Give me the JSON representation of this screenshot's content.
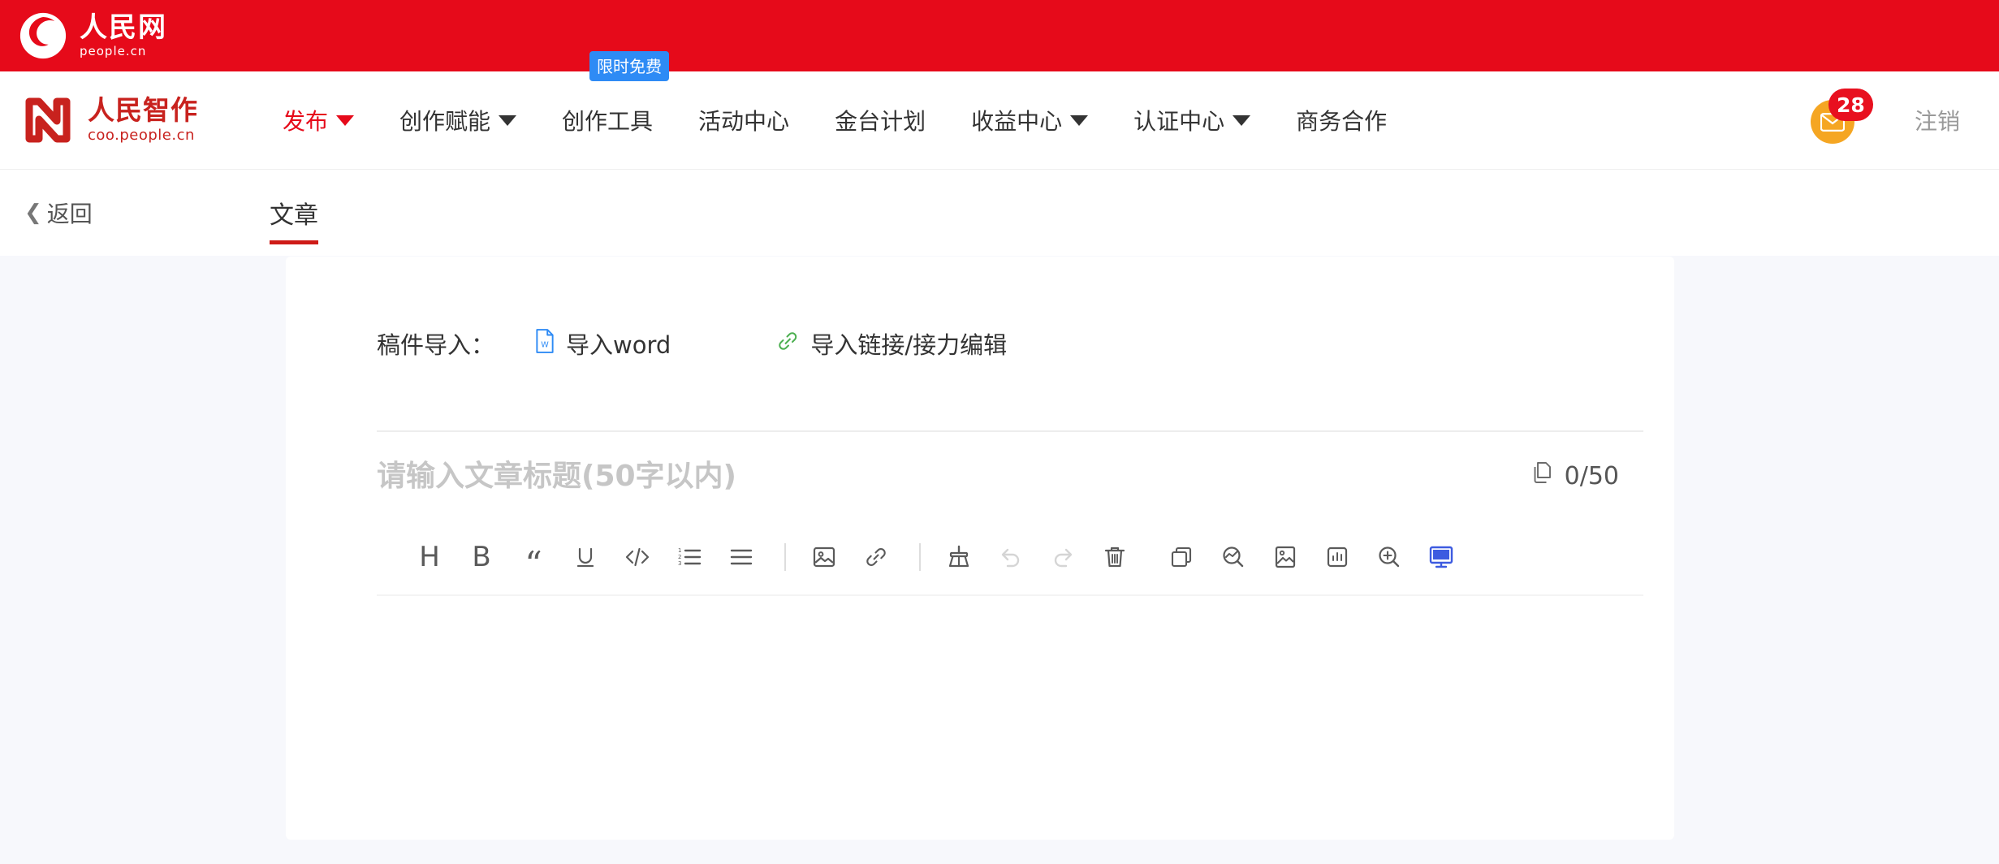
{
  "brand": {
    "cn_name": "人民网",
    "en_name": "people.cn",
    "logo_icon": "people-cn-globe-icon"
  },
  "platform": {
    "cn_name": "人民智作",
    "domain": "coo.people.cn",
    "logo_icon": "zhizuo-n-mark-icon"
  },
  "nav": {
    "items": [
      {
        "label": "发布",
        "caret": true,
        "active": true,
        "ribbon": ""
      },
      {
        "label": "创作赋能",
        "caret": true,
        "active": false,
        "ribbon": ""
      },
      {
        "label": "创作工具",
        "caret": false,
        "active": false,
        "ribbon": "限时免费"
      },
      {
        "label": "活动中心",
        "caret": false,
        "active": false,
        "ribbon": ""
      },
      {
        "label": "金台计划",
        "caret": false,
        "active": false,
        "ribbon": ""
      },
      {
        "label": "收益中心",
        "caret": true,
        "active": false,
        "ribbon": ""
      },
      {
        "label": "认证中心",
        "caret": true,
        "active": false,
        "ribbon": ""
      },
      {
        "label": "商务合作",
        "caret": false,
        "active": false,
        "ribbon": ""
      }
    ],
    "message": {
      "icon": "envelope-icon",
      "badge_count": "28"
    },
    "logout_label": "注销"
  },
  "subheader": {
    "back_label": "返回",
    "back_icon": "chevron-left-icon",
    "tabs": [
      {
        "label": "文章",
        "active": true
      }
    ]
  },
  "editor": {
    "import": {
      "label": "稿件导入：",
      "actions": [
        {
          "label": "导入word",
          "icon": "word-document-icon"
        },
        {
          "label": "导入链接/接力编辑",
          "icon": "link-chain-icon"
        }
      ]
    },
    "title_field": {
      "placeholder": "请输入文章标题(50字以内)",
      "value": ""
    },
    "counter": {
      "icon": "copy-pages-icon",
      "text": "0/50"
    },
    "toolbar": [
      {
        "name": "heading-icon",
        "glyph": "H",
        "type": "text",
        "dim": false
      },
      {
        "name": "bold-icon",
        "glyph": "B",
        "type": "text",
        "dim": false
      },
      {
        "name": "quote-icon",
        "glyph": "“",
        "type": "quote",
        "dim": false
      },
      {
        "name": "underline-icon",
        "glyph": "U",
        "type": "svg",
        "dim": false
      },
      {
        "name": "code-icon",
        "glyph": "</>",
        "type": "svg",
        "dim": false
      },
      {
        "name": "ordered-list-icon",
        "glyph": "",
        "type": "svg",
        "dim": false
      },
      {
        "name": "unordered-list-icon",
        "glyph": "",
        "type": "svg",
        "dim": false
      },
      {
        "name": "separator-1",
        "glyph": "",
        "type": "sep",
        "dim": false
      },
      {
        "name": "insert-image-icon",
        "glyph": "",
        "type": "svg",
        "dim": false
      },
      {
        "name": "insert-link-icon",
        "glyph": "",
        "type": "svg",
        "dim": false
      },
      {
        "name": "separator-2",
        "glyph": "",
        "type": "sep",
        "dim": false
      },
      {
        "name": "clear-format-broom-icon",
        "glyph": "",
        "type": "svg",
        "dim": false
      },
      {
        "name": "undo-icon",
        "glyph": "",
        "type": "svg",
        "dim": true
      },
      {
        "name": "redo-icon",
        "glyph": "",
        "type": "svg",
        "dim": true
      },
      {
        "name": "delete-trash-icon",
        "glyph": "",
        "type": "svg",
        "dim": false
      },
      {
        "name": "copy-icon",
        "glyph": "",
        "type": "svg",
        "dim": false
      },
      {
        "name": "search-chart-icon",
        "glyph": "",
        "type": "svg",
        "dim": false
      },
      {
        "name": "image-library-icon",
        "glyph": "",
        "type": "svg",
        "dim": false
      },
      {
        "name": "bar-chart-icon",
        "glyph": "",
        "type": "svg",
        "dim": false
      },
      {
        "name": "zoom-in-icon",
        "glyph": "",
        "type": "svg",
        "dim": false
      },
      {
        "name": "preview-monitor-icon",
        "glyph": "",
        "type": "svg",
        "dim": false
      }
    ]
  },
  "colors": {
    "brand_red": "#E60A1A",
    "logo_red": "#C8221E",
    "ribbon_blue": "#2E8BF5",
    "badge_red": "#E8101F",
    "message_orange": "#F5A623",
    "page_bg": "#F7F8FC",
    "tab_underline": "#CE1B17",
    "word_icon_blue": "#2E8BF5",
    "link_icon_green": "#4CAF50",
    "monitor_icon_blue": "#3D5BE0"
  }
}
